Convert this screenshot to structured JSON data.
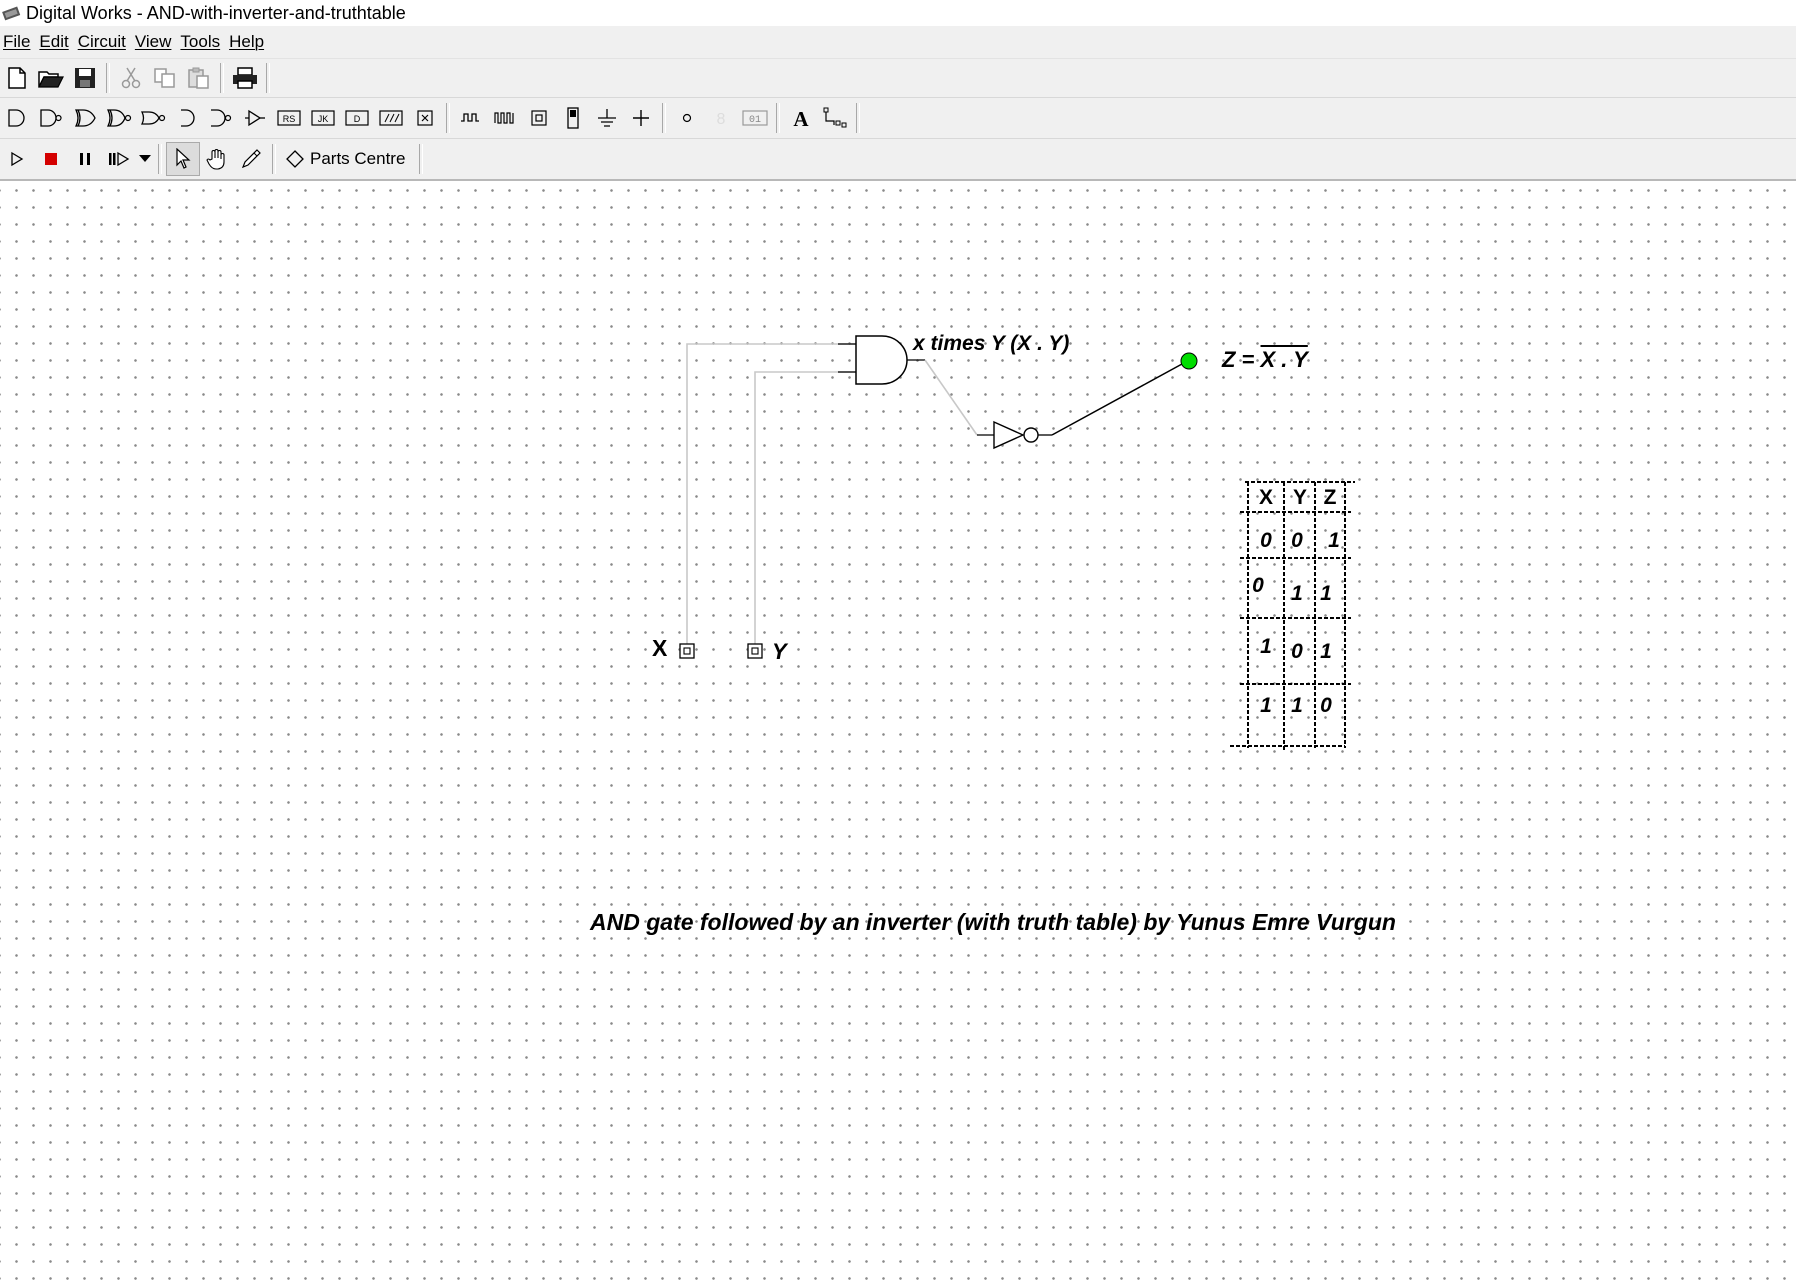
{
  "window": {
    "title": "Digital Works - AND-with-inverter-and-truthtable"
  },
  "menu": [
    "File",
    "Edit",
    "Circuit",
    "View",
    "Tools",
    "Help"
  ],
  "toolbar": {
    "parts_centre_label": "Parts Centre"
  },
  "circuit": {
    "input_x_label": "X",
    "input_y_label": "Y",
    "and_gate_label": "x times Y (X . Y)",
    "output_label_prefix": "Z = ",
    "output_label_expr": "X . Y",
    "output_led_color": "#00dd00",
    "caption": "AND gate followed by an inverter (with truth table) by Yunus Emre Vurgun"
  },
  "truth_table": {
    "headers": [
      "X",
      "Y",
      "Z"
    ],
    "rows": [
      [
        "0",
        "0",
        "1"
      ],
      [
        "0",
        "1",
        "1"
      ],
      [
        "1",
        "0",
        "1"
      ],
      [
        "1",
        "1",
        "0"
      ]
    ]
  }
}
